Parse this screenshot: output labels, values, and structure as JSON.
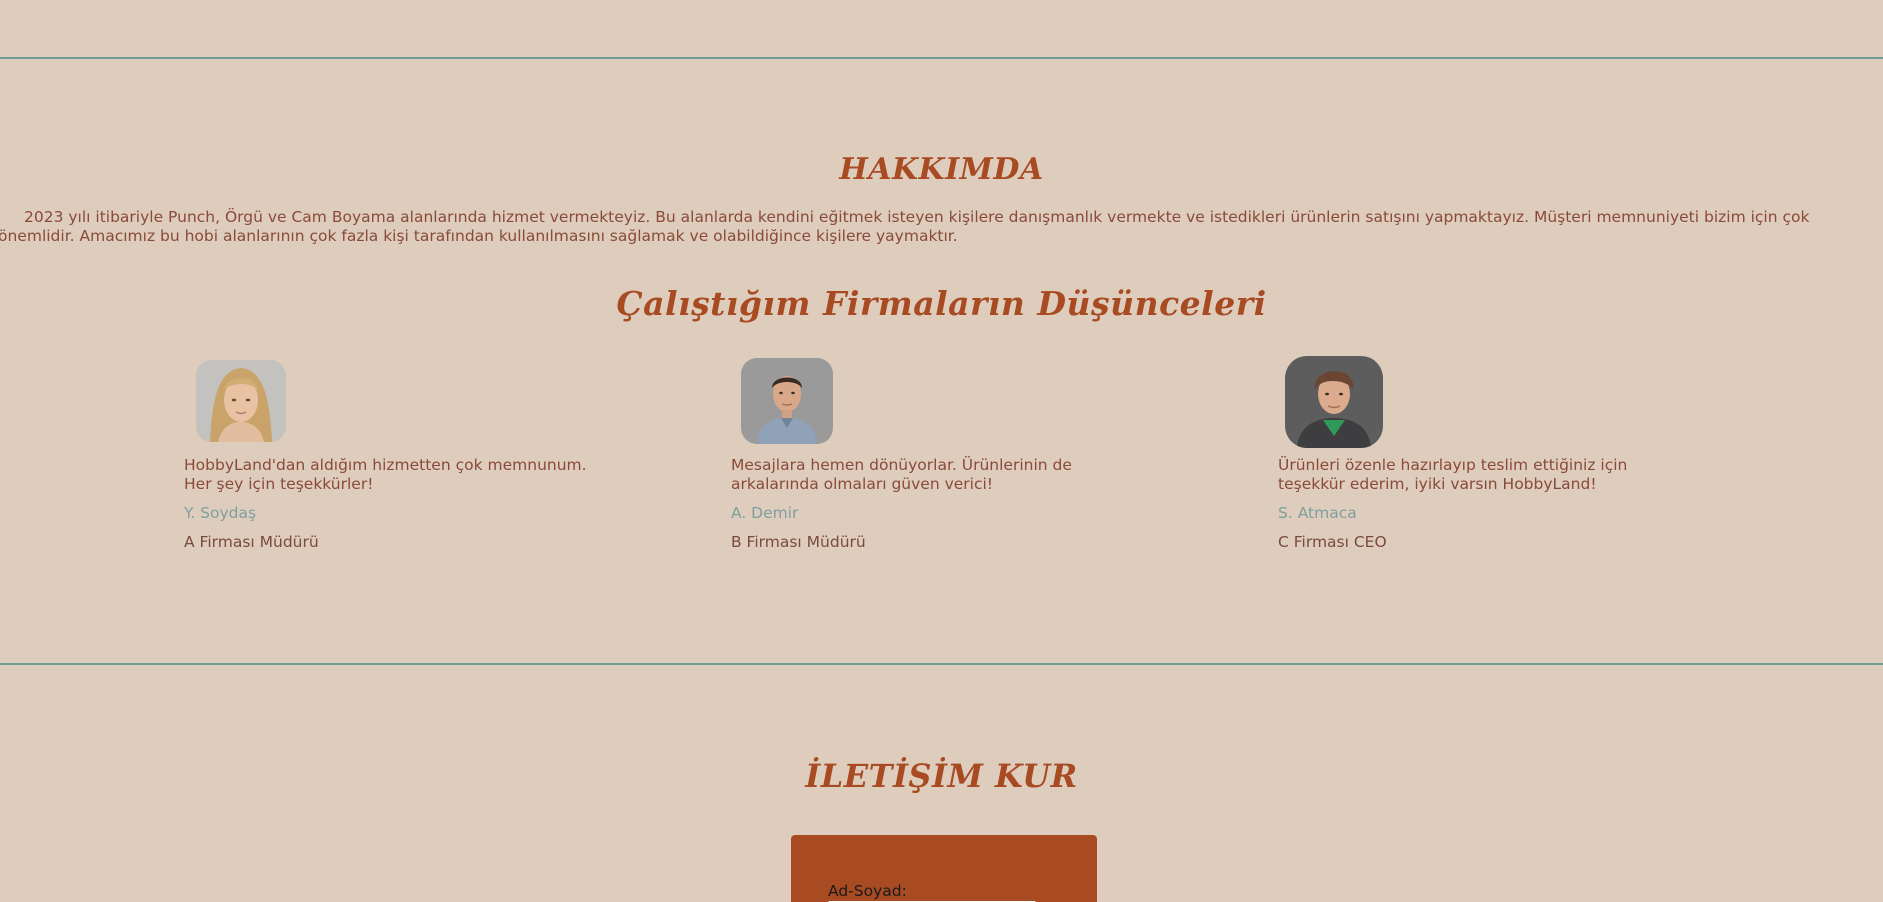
{
  "about": {
    "title": "HAKKIMDA",
    "text": "2023 yılı itibariyle Punch, Örgü ve Cam Boyama alanlarında hizmet vermekteyiz. Bu alanlarda kendini eğitmek isteyen kişilere danışmanlık vermekte ve istedikleri ürünlerin satışını yapmaktayız. Müşteri memnuniyeti bizim için çok önemlidir. Amacımız bu hobi alanlarının çok fazla kişi tarafından kullanılmasını sağlamak ve olabildiğince kişilere yaymaktır."
  },
  "testimonials": {
    "title": "Çalıştığım Firmaların Düşünceleri",
    "items": [
      {
        "quote": "HobbyLand'dan aldığım hizmetten çok memnunum. Her şey için teşekkürler!",
        "author": "Y. Soydaş",
        "role": "A Firması Müdürü",
        "avatar": "woman-portrait"
      },
      {
        "quote": "Mesajlara hemen dönüyorlar. Ürünlerinin de arkalarında olmaları güven verici!",
        "author": "A. Demir",
        "role": "B Firması Müdürü",
        "avatar": "man-portrait"
      },
      {
        "quote": "Ürünleri özenle hazırlayıp teslim ettiğiniz için teşekkür ederim, iyiki varsın HobbyLand!",
        "author": "S. Atmaca",
        "role": "C Firması CEO",
        "avatar": "young-man-portrait"
      }
    ]
  },
  "contact": {
    "title": "İLETİŞİM KUR",
    "name_label": "Ad-Soyad:",
    "name_value": ""
  },
  "colors": {
    "background": "#decdbd",
    "accent": "#a84a22",
    "divider": "#6e9b96",
    "author": "#7f9f9e",
    "text": "#8a4a3a"
  }
}
